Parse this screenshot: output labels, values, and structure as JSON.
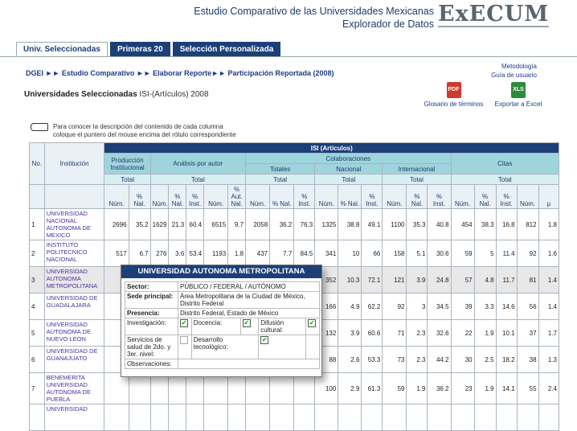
{
  "header": {
    "title1": "Estudio Comparativo de las Universidades Mexicanas",
    "title2": "Explorador de Datos",
    "logo": "ExECUM"
  },
  "tabs": [
    "Univ. Seleccionadas",
    "Primeras 20",
    "Selección Personalizada"
  ],
  "breadcrumb": "DGEI ►► Estudio Comparativo ►► Elaborar Reporte►► Participación Reportada (2008)",
  "links": {
    "metodologia": "Metodología",
    "guia": "Guía de usuario"
  },
  "subtitle": {
    "bold": "Universidades Seleccionadas",
    "rest": " ISI-(Artículos) 2008"
  },
  "tools": [
    {
      "icon": "PDF",
      "label": "Glosario de términos"
    },
    {
      "icon": "XLS",
      "label": "Exportar a Excel"
    }
  ],
  "hint": {
    "line1": "Para conocer la descripción del contenido de cada columna",
    "line2": "coloque el puntero del mouse encima del rótulo correspondiente"
  },
  "table": {
    "no": "No.",
    "institucion": "Institución",
    "isi": "ISI (Artículos)",
    "produccion": "Producción Institucional",
    "analisis": "Análisis por autor",
    "colaboraciones": "Colaboraciones",
    "citas": "Citas",
    "totales": "Totales",
    "nacional": "Nacional",
    "internacional": "Internacional",
    "total": "Total",
    "cols": [
      "Núm.",
      "% Nal.",
      "Núm.",
      "% Nal.",
      "% Inst.",
      "Núm.",
      "% Aut. Nal.",
      "Núm.",
      "% Nal.",
      "% Inst.",
      "Núm.",
      "% Nal.",
      "% Inst.",
      "Núm.",
      "% Nal.",
      "% Inst.",
      "Núm.",
      "% Nal.",
      "% Inst.",
      "Núm.",
      "μ"
    ],
    "rows": [
      {
        "no": "1",
        "name": "UNIVERSIDAD NACIONAL AUTONOMA DE MEXICO",
        "v": [
          "2696",
          "35.2",
          "1629",
          "21.3",
          "60.4",
          "6515",
          "9.7",
          "2058",
          "36.2",
          "76.3",
          "1325",
          "38.8",
          "49.1",
          "1100",
          "35.3",
          "40.8",
          "454",
          "38.3",
          "16.8",
          "812",
          "1.8"
        ]
      },
      {
        "no": "2",
        "name": "INSTITUTO POLITECNICO NACIONAL",
        "v": [
          "517",
          "6.7",
          "276",
          "3.6",
          "53.4",
          "1193",
          "1.8",
          "437",
          "7.7",
          "84.5",
          "341",
          "10",
          "66",
          "158",
          "5.1",
          "30.6",
          "59",
          "5",
          "11.4",
          "92",
          "1.6"
        ]
      },
      {
        "no": "3",
        "name": "UNIVERSIDAD AUTONOMA METROPOLITANA",
        "v": [
          "",
          "",
          "",
          "",
          "",
          "",
          "",
          "",
          "",
          "",
          "352",
          "10.3",
          "72.1",
          "121",
          "3.9",
          "24.8",
          "57",
          "4.8",
          "11.7",
          "81",
          "1.4"
        ]
      },
      {
        "no": "4",
        "name": "UNIVERSIDAD DE GUADALAJARA",
        "v": [
          "",
          "",
          "",
          "",
          "",
          "",
          "",
          "",
          "",
          "",
          "166",
          "4.9",
          "62.2",
          "92",
          "3",
          "34.5",
          "39",
          "3.3",
          "14.6",
          "56",
          "1.4"
        ]
      },
      {
        "no": "5",
        "name": "UNIVERSIDAD AUTONOMA DE NUEVO LEON",
        "v": [
          "",
          "",
          "",
          "",
          "",
          "",
          "",
          "",
          "",
          "",
          "132",
          "3.9",
          "60.6",
          "71",
          "2.3",
          "32.6",
          "22",
          "1.9",
          "10.1",
          "37",
          "1.7"
        ]
      },
      {
        "no": "6",
        "name": "UNIVERSIDAD DE GUANAJUATO",
        "v": [
          "",
          "",
          "",
          "",
          "",
          "",
          "",
          "",
          "",
          "",
          "88",
          "2.6",
          "53.3",
          "73",
          "2.3",
          "44.2",
          "30",
          "2.5",
          "18.2",
          "38",
          "1.3"
        ]
      },
      {
        "no": "7",
        "name": "BENEMERITA UNIVERSIDAD AUTONOMA DE PUEBLA",
        "v": [
          "",
          "",
          "",
          "",
          "",
          "",
          "",
          "",
          "",
          "",
          "100",
          "2.9",
          "61.3",
          "59",
          "1.9",
          "36.2",
          "23",
          "1.9",
          "14.1",
          "55",
          "2.4"
        ]
      },
      {
        "no": "",
        "name": "UNIVERSIDAD",
        "v": [
          "",
          "",
          "",
          "",
          "",
          "",
          "",
          "",
          "",
          "",
          "",
          "",
          "",
          "",
          "",
          "",
          "",
          "",
          "",
          "",
          ""
        ]
      }
    ]
  },
  "popup": {
    "title": "UNIVERSIDAD AUTONOMA METROPOLITANA",
    "sector_k": "Sector:",
    "sector_v": "PÚBLICO / FEDERAL / AUTÓNOMO",
    "sede_k": "Sede principal:",
    "sede_v": "Área Metropolitana de la Ciudad de México, Distrito Federal",
    "presencia_k": "Presencia:",
    "presencia_v": "Distrito Federal, Estado de México",
    "investigacion": "Investigación:",
    "docencia": "Docencia:",
    "difusion": "Difusión cultural:",
    "salud": "Servicios de salud de 2do. y 3er. nivel:",
    "desarrollo": "Desarrollo tecnológico:",
    "observaciones": "Observaciones:"
  }
}
